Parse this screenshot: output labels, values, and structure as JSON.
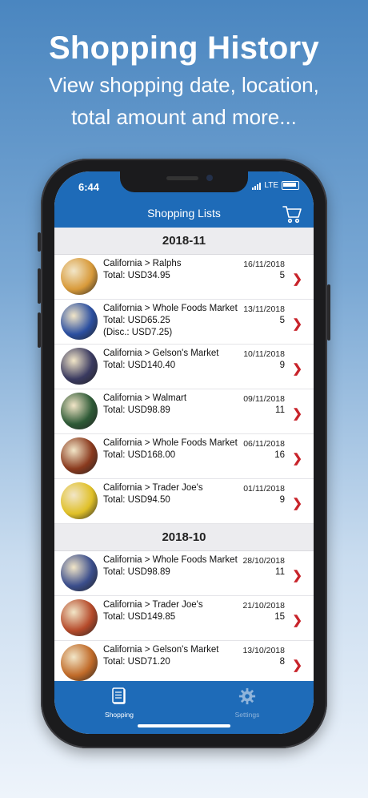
{
  "promo": {
    "title": "Shopping History",
    "subtitle_line1": "View shopping date, location,",
    "subtitle_line2": "total amount and more..."
  },
  "status_bar": {
    "time": "6:44",
    "network": "LTE"
  },
  "nav": {
    "title": "Shopping Lists",
    "cart_icon": "cart-icon"
  },
  "sections": [
    {
      "title": "2018-11",
      "rows": [
        {
          "store": "California > Ralphs",
          "total": "Total: USD34.95",
          "discount": "",
          "date": "16/11/2018",
          "count": "5",
          "thumb_color": "#d89a3a"
        },
        {
          "store": "California > Whole Foods Market",
          "total": "Total: USD65.25",
          "discount": "(Disc.: USD7.25)",
          "date": "13/11/2018",
          "count": "5",
          "thumb_color": "#2b4fa0"
        },
        {
          "store": "California > Gelson's Market",
          "total": "Total: USD140.40",
          "discount": "",
          "date": "10/11/2018",
          "count": "9",
          "thumb_color": "#3a3a60"
        },
        {
          "store": "California > Walmart",
          "total": "Total: USD98.89",
          "discount": "",
          "date": "09/11/2018",
          "count": "11",
          "thumb_color": "#2e5a36"
        },
        {
          "store": "California > Whole Foods Market",
          "total": "Total: USD168.00",
          "discount": "",
          "date": "06/11/2018",
          "count": "16",
          "thumb_color": "#8a3a1e"
        },
        {
          "store": "California > Trader Joe's",
          "total": "Total: USD94.50",
          "discount": "",
          "date": "01/11/2018",
          "count": "9",
          "thumb_color": "#e0c028"
        }
      ]
    },
    {
      "title": "2018-10",
      "rows": [
        {
          "store": "California > Whole Foods Market",
          "total": "Total: USD98.89",
          "discount": "",
          "date": "28/10/2018",
          "count": "11",
          "thumb_color": "#3b4e8c"
        },
        {
          "store": "California > Trader Joe's",
          "total": "Total: USD149.85",
          "discount": "",
          "date": "21/10/2018",
          "count": "15",
          "thumb_color": "#b54a2a"
        },
        {
          "store": "California > Gelson's Market",
          "total": "Total: USD71.20",
          "discount": "",
          "date": "13/10/2018",
          "count": "8",
          "thumb_color": "#c06a28"
        }
      ]
    }
  ],
  "tabs": [
    {
      "label": "Shopping",
      "icon": "shopping-list-icon",
      "active": true
    },
    {
      "label": "Settings",
      "icon": "gear-icon",
      "active": false
    }
  ],
  "colors": {
    "brand_blue": "#1e6bb8",
    "chevron_red": "#c8242b",
    "section_bg": "#ececef"
  }
}
